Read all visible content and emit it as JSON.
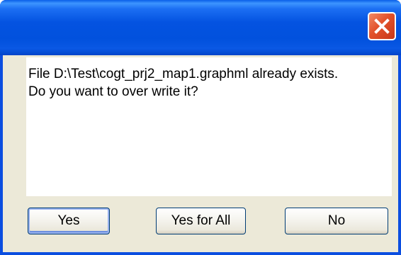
{
  "dialog": {
    "title": "",
    "message_lines": [
      "File D:\\Test\\cogt_prj2_map1.graphml already exists.",
      "Do you want to over write it?"
    ],
    "close_icon": "close-icon"
  },
  "buttons": {
    "yes_label": "Yes",
    "yes_all_label": "Yes for All",
    "no_label": "No"
  },
  "colors": {
    "titlebar": "#0453e1",
    "close_button": "#e2512a",
    "window_body": "#ece9d8",
    "message_background": "#ffffff"
  }
}
